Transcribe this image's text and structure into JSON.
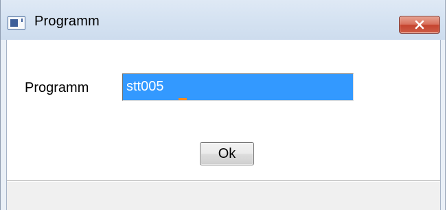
{
  "window": {
    "title": "Programm",
    "close_symbol": "×",
    "icon": "application-window-icon"
  },
  "form": {
    "label": "Programm",
    "input_value": "stt005"
  },
  "buttons": {
    "ok_label": "Ok"
  },
  "colors": {
    "title_bar": "#d6e3f2",
    "close_button": "#c5442f",
    "input_selection": "#3399ff",
    "caret": "#ff8a1a"
  }
}
